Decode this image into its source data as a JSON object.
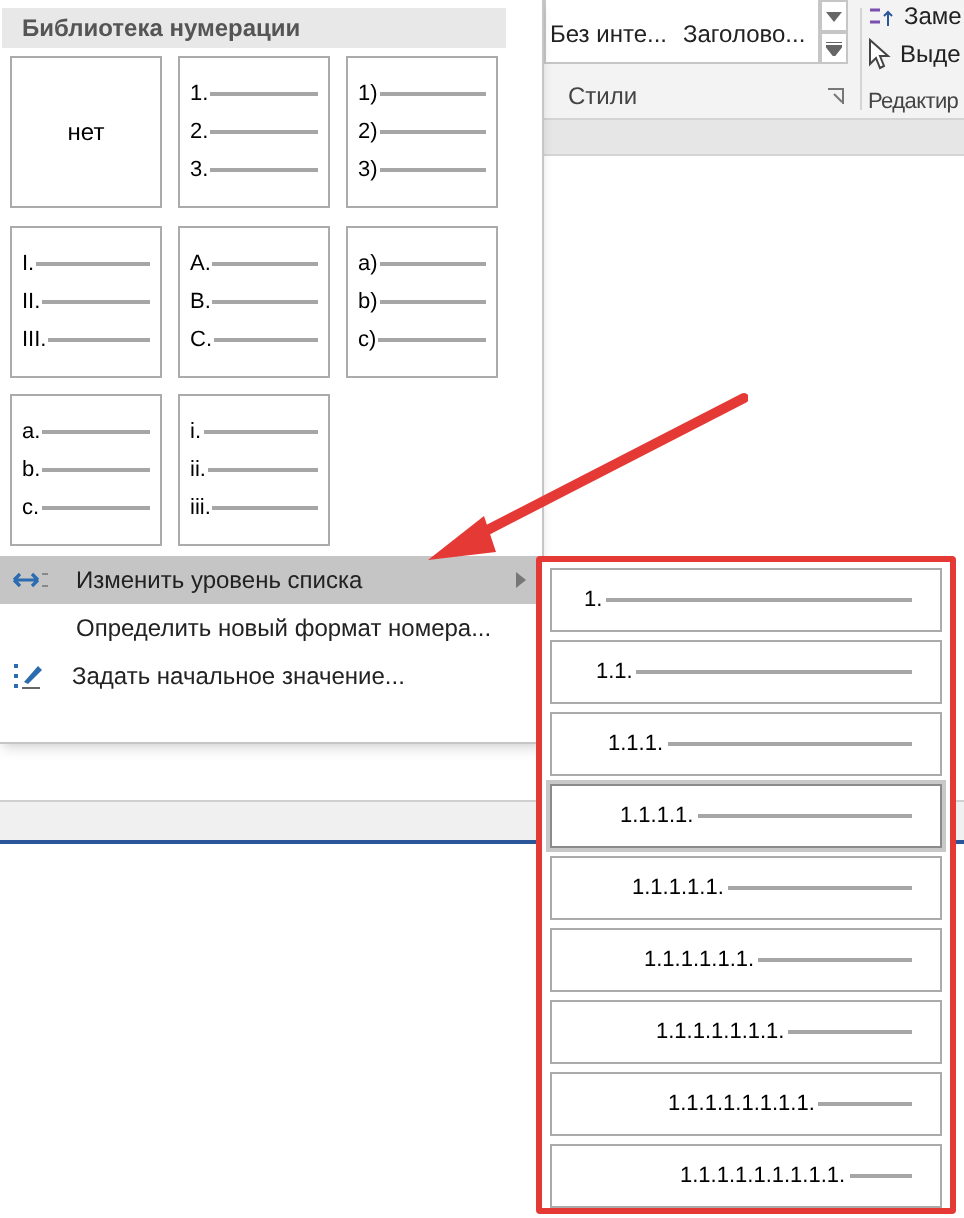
{
  "ribbon": {
    "styles": [
      "Без инте...",
      "Заголово..."
    ],
    "styles_group": "Стили",
    "editing": [
      {
        "kind": "replace",
        "label": "Заме"
      },
      {
        "kind": "select",
        "label": "Выде"
      }
    ],
    "editing_group": "Редактир"
  },
  "numbering_menu": {
    "header": "Библиотека нумерации",
    "tiles": [
      {
        "kind": "none",
        "label": "нет"
      },
      {
        "kind": "list",
        "markers": [
          "1.",
          "2.",
          "3."
        ]
      },
      {
        "kind": "list",
        "markers": [
          "1)",
          "2)",
          "3)"
        ]
      },
      {
        "kind": "list",
        "markers": [
          "I.",
          "II.",
          "III."
        ]
      },
      {
        "kind": "list",
        "markers": [
          "A.",
          "B.",
          "C."
        ]
      },
      {
        "kind": "list",
        "markers": [
          "a)",
          "b)",
          "c)"
        ]
      },
      {
        "kind": "list",
        "markers": [
          "a.",
          "b.",
          "c."
        ]
      },
      {
        "kind": "list",
        "markers": [
          "i.",
          "ii.",
          "iii."
        ]
      }
    ],
    "items": [
      {
        "kind": "level",
        "label": "Изменить уровень списка",
        "selected": true,
        "submenu": true
      },
      {
        "kind": "define",
        "label": "Определить новый формат номера...",
        "selected": false,
        "submenu": false
      },
      {
        "kind": "start",
        "label": "Задать начальное значение...",
        "selected": false,
        "submenu": false
      }
    ]
  },
  "levels": [
    {
      "label": "1.",
      "selected": false
    },
    {
      "label": "1.1.",
      "selected": false
    },
    {
      "label": "1.1.1.",
      "selected": false
    },
    {
      "label": "1.1.1.1.",
      "selected": true
    },
    {
      "label": "1.1.1.1.1.",
      "selected": false
    },
    {
      "label": "1.1.1.1.1.1.",
      "selected": false
    },
    {
      "label": "1.1.1.1.1.1.1.",
      "selected": false
    },
    {
      "label": "1.1.1.1.1.1.1.1.",
      "selected": false
    },
    {
      "label": "1.1.1.1.1.1.1.1.1.",
      "selected": false
    }
  ]
}
